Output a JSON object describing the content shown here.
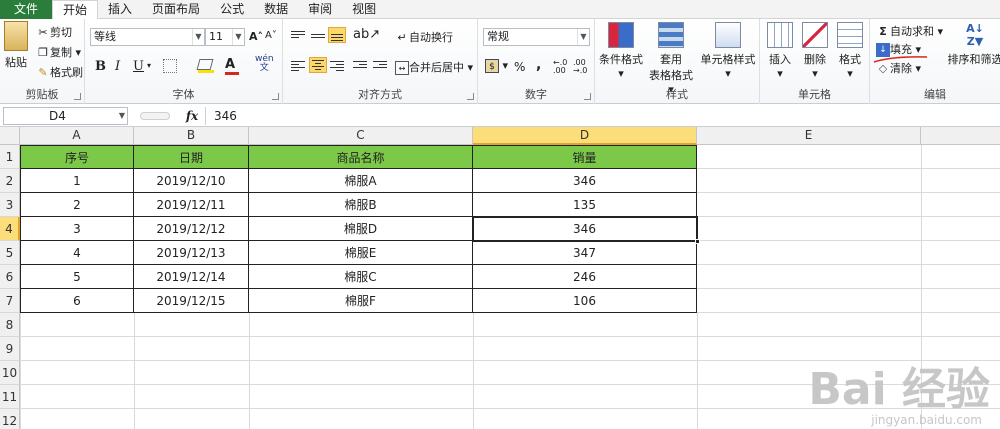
{
  "menu": {
    "tabs": [
      {
        "label": "文件"
      },
      {
        "label": "开始"
      },
      {
        "label": "插入"
      },
      {
        "label": "页面布局"
      },
      {
        "label": "公式"
      },
      {
        "label": "数据"
      },
      {
        "label": "审阅"
      },
      {
        "label": "视图"
      }
    ],
    "active_tab": "开始"
  },
  "ribbon": {
    "clipboard": {
      "paste": "粘贴",
      "cut": "剪切",
      "copy": "复制",
      "format_painter": "格式刷",
      "label": "剪贴板"
    },
    "font": {
      "name": "等线",
      "size": "11",
      "label": "字体",
      "bold": "B",
      "italic": "I",
      "underline": "U",
      "grow": "A˄",
      "shrink": "A˅",
      "phonetic": "wén"
    },
    "alignment": {
      "wrap": "自动换行",
      "merge": "合并后居中",
      "label": "对齐方式"
    },
    "number": {
      "format": "常规",
      "percent": "%",
      "comma": ",",
      "label": "数字"
    },
    "styles": {
      "conditional": "条件格式",
      "table": "套用\n表格格式",
      "table_line1": "套用",
      "table_line2": "表格格式",
      "cell_styles": "单元格样式",
      "label": "样式"
    },
    "cells": {
      "insert": "插入",
      "delete": "删除",
      "format": "格式",
      "label": "单元格"
    },
    "editing": {
      "autosum": "自动求和",
      "fill": "填充",
      "clear": "清除",
      "sort_filter": "排序和筛选",
      "label": "编辑"
    },
    "colors": {
      "font_red": "#d9261c",
      "highlight_yellow": "#ffe000",
      "fill_annotation": "#d9261c"
    }
  },
  "formula_bar": {
    "name_box": "D4",
    "fx": "fx",
    "value": "346"
  },
  "sheet": {
    "columns": [
      "A",
      "B",
      "C",
      "D",
      "E"
    ],
    "rows": [
      "1",
      "2",
      "3",
      "4",
      "5",
      "6",
      "7",
      "8",
      "9",
      "10",
      "11",
      "12"
    ],
    "selected_cell": "D4",
    "header_fill": "#7cc94a",
    "table": {
      "headers": [
        "序号",
        "日期",
        "商品名称",
        "销量"
      ],
      "data": [
        [
          "1",
          "2019/12/10",
          "棉服A",
          "346"
        ],
        [
          "2",
          "2019/12/11",
          "棉服B",
          "135"
        ],
        [
          "3",
          "2019/12/12",
          "棉服D",
          "346"
        ],
        [
          "4",
          "2019/12/13",
          "棉服E",
          "347"
        ],
        [
          "5",
          "2019/12/14",
          "棉服C",
          "246"
        ],
        [
          "6",
          "2019/12/15",
          "棉服F",
          "106"
        ]
      ]
    }
  },
  "watermark": {
    "text": "Bai 经验",
    "sub": "jingyan.baidu.com"
  }
}
